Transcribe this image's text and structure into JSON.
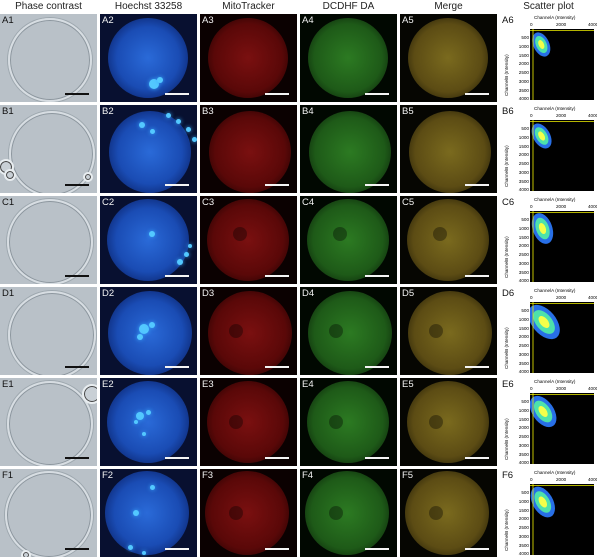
{
  "headers": [
    "Phase contrast",
    "Hoechst 33258",
    "MitoTracker",
    "DCDHF DA",
    "Merge",
    "Scatter plot"
  ],
  "rows": [
    "A",
    "B",
    "C",
    "D",
    "E",
    "F"
  ],
  "panel_labels": [
    [
      "A1",
      "A2",
      "A3",
      "A4",
      "A5",
      "A6"
    ],
    [
      "B1",
      "B2",
      "B3",
      "B4",
      "B5",
      "B6"
    ],
    [
      "C1",
      "C2",
      "C3",
      "C4",
      "C5",
      "C6"
    ],
    [
      "D1",
      "D2",
      "D3",
      "D4",
      "D5",
      "D6"
    ],
    [
      "E1",
      "E2",
      "E3",
      "E4",
      "E5",
      "E6"
    ],
    [
      "F1",
      "F2",
      "F3",
      "F4",
      "F5",
      "F6"
    ]
  ],
  "scatter": {
    "x_title": "ChannelA (Intensity)",
    "y_title": "ChannelB (Intensity)",
    "x_ticks": [
      "0",
      "2000",
      "4000"
    ],
    "y_ticks": [
      "500",
      "1000",
      "1500",
      "2000",
      "2500",
      "3000",
      "3500",
      "4000"
    ],
    "colors": {
      "low": "#2c7bff",
      "mid": "#4fe8a8",
      "high": "#f4ff4a",
      "line": "#f0f000"
    }
  }
}
